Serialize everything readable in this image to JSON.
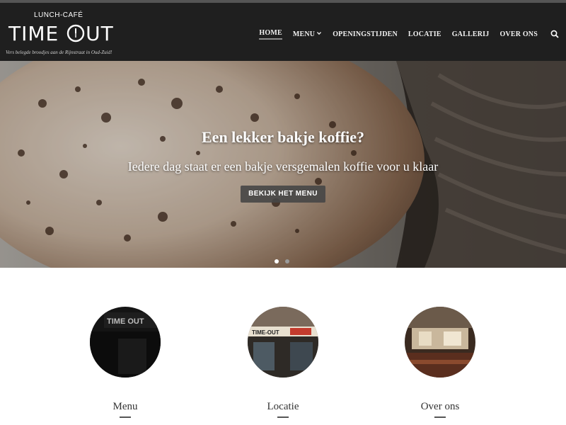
{
  "brand": {
    "small_label": "LUNCH-CAFÉ",
    "name_part1": "TIME ",
    "name_part2": "UT",
    "tagline": "Vers belegde broodjes aan de Rijnstraat in Oud-Zuid!"
  },
  "nav": {
    "items": [
      {
        "label": "HOME",
        "active": true
      },
      {
        "label": "MENU",
        "has_dropdown": true
      },
      {
        "label": "OPENINGSTIJDEN"
      },
      {
        "label": "LOCATIE"
      },
      {
        "label": "GALLERIJ"
      },
      {
        "label": "OVER ONS"
      }
    ],
    "search_icon": "search-icon"
  },
  "hero": {
    "title": "Een lekker bakje koffie?",
    "subtitle": "Iedere dag staat er een bakje versgemalen koffie voor u klaar",
    "button_label": "BEKIJK HET MENU",
    "slides_total": 2,
    "active_slide": 1
  },
  "features": [
    {
      "label": "Menu",
      "image": "time-out-sign-photo"
    },
    {
      "label": "Locatie",
      "image": "storefront-photo"
    },
    {
      "label": "Over ons",
      "image": "cafe-interior-photo"
    }
  ],
  "colors": {
    "header_bg": "#1f1f1f",
    "text_light": "#ffffff",
    "button_bg": "#464646"
  }
}
